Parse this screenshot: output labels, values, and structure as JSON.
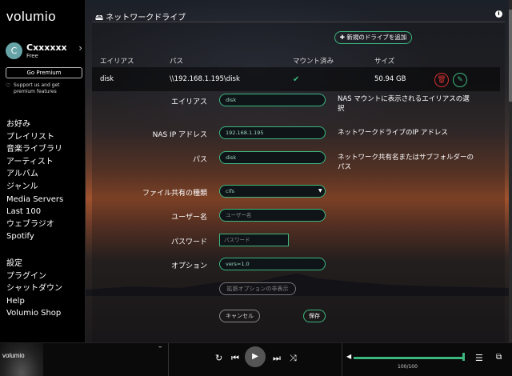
{
  "app": {
    "logo": "volumio"
  },
  "user": {
    "avatar_initial": "C",
    "name": "Cxxxxxx",
    "plan": "Free"
  },
  "sidebar": {
    "premium_label": "Go Premium",
    "support_text": "Support us and get premium features",
    "nav_main": [
      "お好み",
      "プレイリスト",
      "音楽ライブラリ",
      "アーティスト",
      "アルバム",
      "ジャンル",
      "Media Servers",
      "Last 100",
      "ウェブラジオ",
      "Spotify"
    ],
    "nav_settings": [
      "設定",
      "プラグイン",
      "シャットダウン",
      "Help",
      "Volumio Shop"
    ]
  },
  "header": {
    "title": "ネットワークドライブ"
  },
  "actions": {
    "add_drive": "新規のドライブを追加"
  },
  "table": {
    "headers": [
      "エイリアス",
      "パス",
      "マウント済み",
      "サイズ"
    ],
    "row": {
      "alias": "disk",
      "path": "\\\\192.168.1.195\\disk",
      "size": "50.94 GB"
    }
  },
  "form": {
    "alias": {
      "label": "エイリアス",
      "value": "disk",
      "help": "NAS マウントに表示されるエイリアスの選択"
    },
    "nas_ip": {
      "label": "NAS IP アドレス",
      "value": "192.168.1.195",
      "help": "ネットワークドライブのIP アドレス"
    },
    "path": {
      "label": "パス",
      "value": "disk",
      "help": "ネットワーク共有名またはサブフォルダーのパス"
    },
    "share_type": {
      "label": "ファイル共有の種類",
      "value": "cifs"
    },
    "username": {
      "label": "ユーザー名",
      "placeholder": "ユーザー名"
    },
    "password": {
      "label": "パスワード",
      "placeholder": "パスワード"
    },
    "options": {
      "label": "オプション",
      "value": "vers=1.0"
    },
    "advanced_label": "拡張オプションの非表示",
    "cancel_label": "キャンセル",
    "save_label": "保存"
  },
  "player": {
    "track_dash": "–",
    "volume_text": "100/100",
    "volume_level": 1.0
  },
  "colors": {
    "accent": "#3bb77e",
    "danger": "#d32f2f"
  }
}
